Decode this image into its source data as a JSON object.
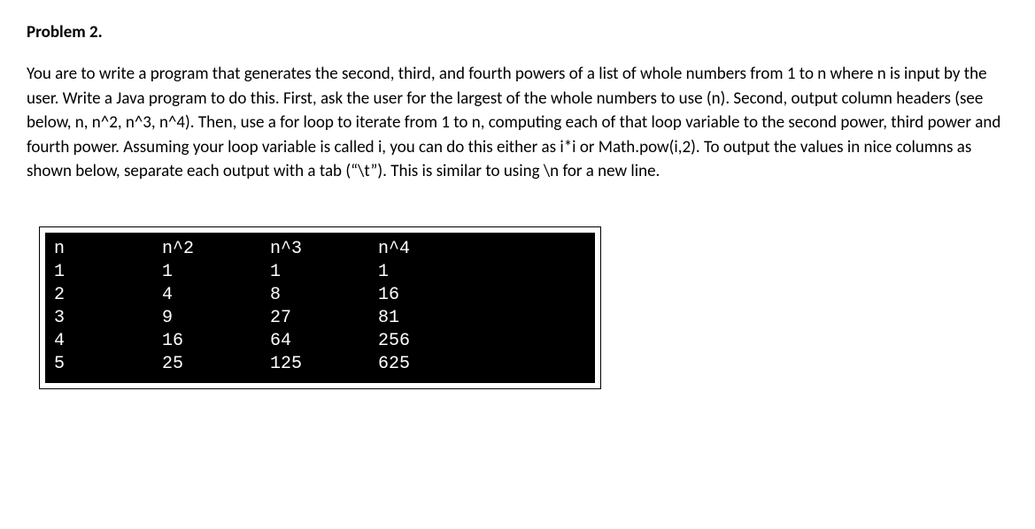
{
  "problem": {
    "title": "Problem 2.",
    "body": "You are to write a program that generates the second, third, and fourth powers of a list of whole numbers from 1 to n where n is input by the user. Write a Java program to do this. First, ask the user for the largest of the whole numbers to use (n). Second, output column headers (see below, n, n^2, n^3, n^4). Then, use a for loop to iterate from 1 to n, computing each of that loop variable to the second power, third power and fourth power. Assuming your loop variable is called i, you can do this either as i*i or Math.pow(i,2). To output the values in nice columns as shown below, separate each output with a tab (“\\t”). This is similar to using \\n for a new line."
  },
  "chart_data": {
    "type": "table",
    "headers": [
      "n",
      "n^2",
      "n^3",
      "n^4"
    ],
    "rows": [
      [
        "1",
        "1",
        "1",
        "1"
      ],
      [
        "2",
        "4",
        "8",
        "16"
      ],
      [
        "3",
        "9",
        "27",
        "81"
      ],
      [
        "4",
        "16",
        "64",
        "256"
      ],
      [
        "5",
        "25",
        "125",
        "625"
      ]
    ]
  }
}
